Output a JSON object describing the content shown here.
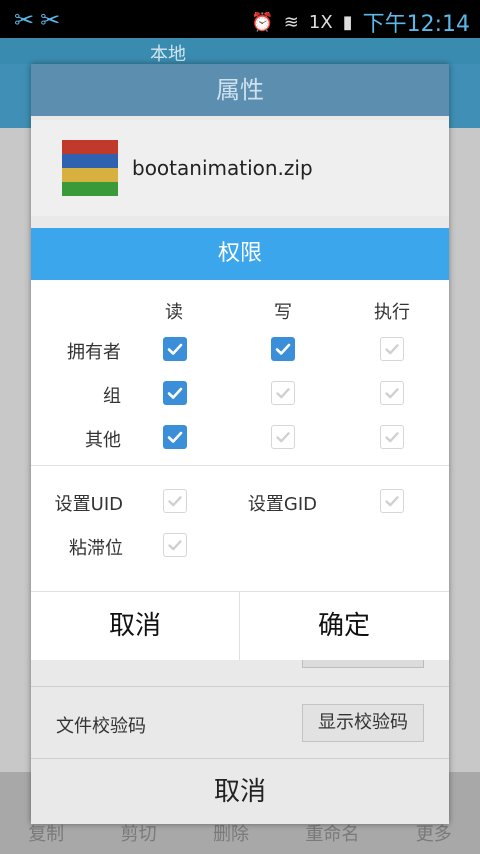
{
  "status_bar": {
    "time": "下午12:14",
    "network_label": "1X"
  },
  "background": {
    "path_label": "本地",
    "bottom_bar": [
      "复制",
      "剪切",
      "删除",
      "重命名",
      "更多"
    ]
  },
  "properties_dialog": {
    "title": "属性",
    "file_name": "bootanimation.zip",
    "checksum_label": "文件校验码",
    "checksum_button": "显示校验码",
    "cancel_button": "取消"
  },
  "permissions_dialog": {
    "title": "权限",
    "columns": [
      "读",
      "写",
      "执行"
    ],
    "rows": [
      {
        "label": "拥有者",
        "read": true,
        "write": true,
        "execute": false
      },
      {
        "label": "组",
        "read": true,
        "write": false,
        "execute": false
      },
      {
        "label": "其他",
        "read": true,
        "write": false,
        "execute": false
      }
    ],
    "set_uid_label": "设置UID",
    "set_uid": false,
    "set_gid_label": "设置GID",
    "set_gid": false,
    "sticky_label": "粘滞位",
    "sticky": false,
    "cancel_button": "取消",
    "ok_button": "确定"
  },
  "colors": {
    "accent": "#3ca6ec",
    "checkbox_on": "#3a8fd8"
  }
}
